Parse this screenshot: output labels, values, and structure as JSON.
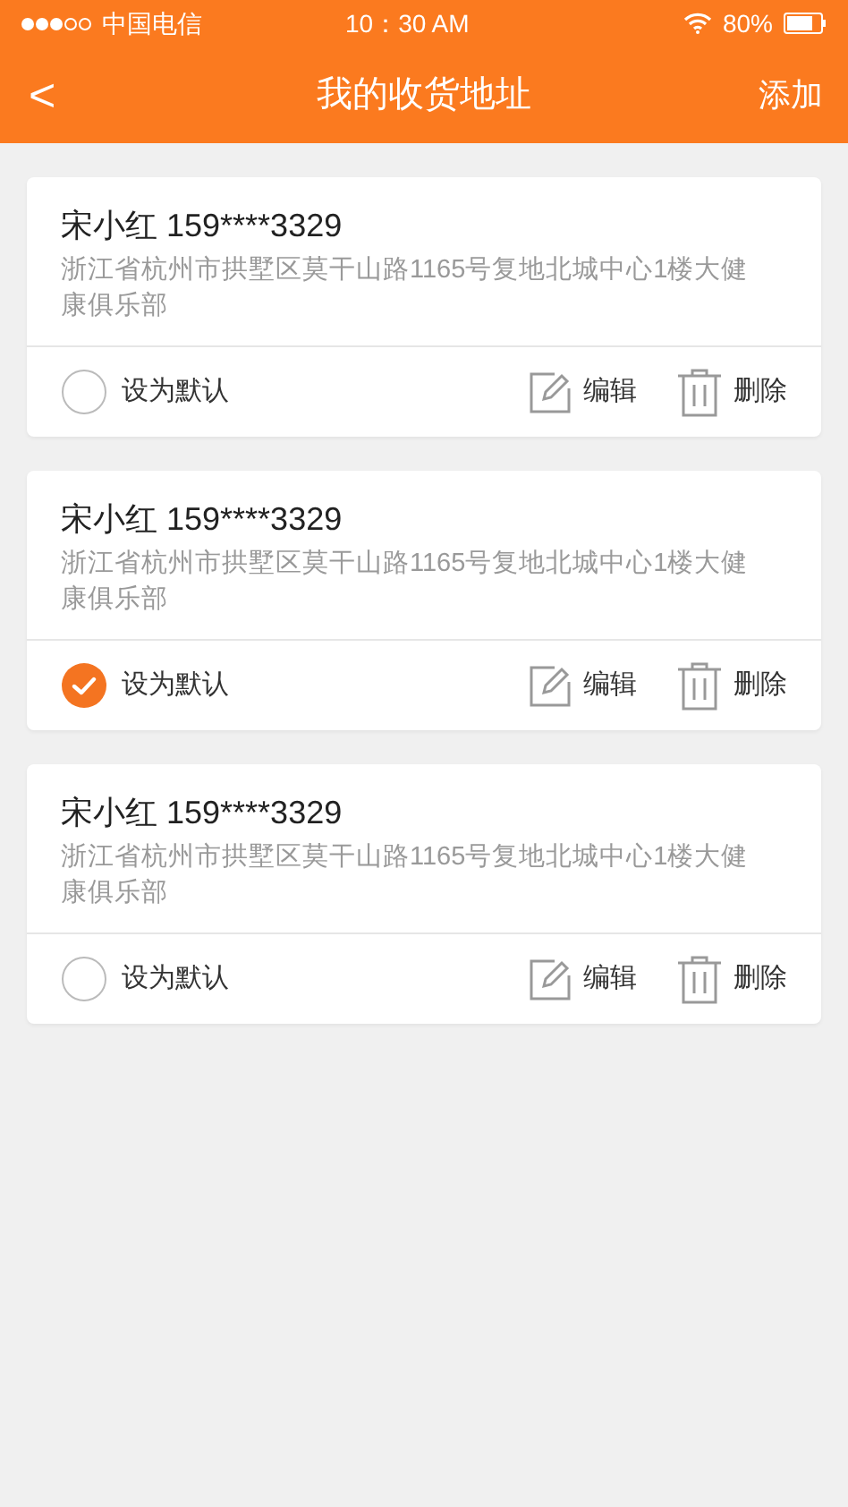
{
  "status_bar": {
    "carrier": "中国电信",
    "time": "10：30 AM",
    "battery": "80%"
  },
  "nav": {
    "back": "<",
    "title": "我的收货地址",
    "action": "添加"
  },
  "addresses": [
    {
      "name_phone": "宋小红 159****3329",
      "address": "浙江省杭州市拱墅区莫干山路1165号复地北城中心1楼大健康俱乐部",
      "default_label": "设为默认",
      "selected": false,
      "edit": "编辑",
      "delete": "删除"
    },
    {
      "name_phone": "宋小红 159****3329",
      "address": "浙江省杭州市拱墅区莫干山路1165号复地北城中心1楼大健康俱乐部",
      "default_label": "设为默认",
      "selected": true,
      "edit": "编辑",
      "delete": "删除"
    },
    {
      "name_phone": "宋小红 159****3329",
      "address": "浙江省杭州市拱墅区莫干山路1165号复地北城中心1楼大健康俱乐部",
      "default_label": "设为默认",
      "selected": false,
      "edit": "编辑",
      "delete": "删除"
    }
  ]
}
